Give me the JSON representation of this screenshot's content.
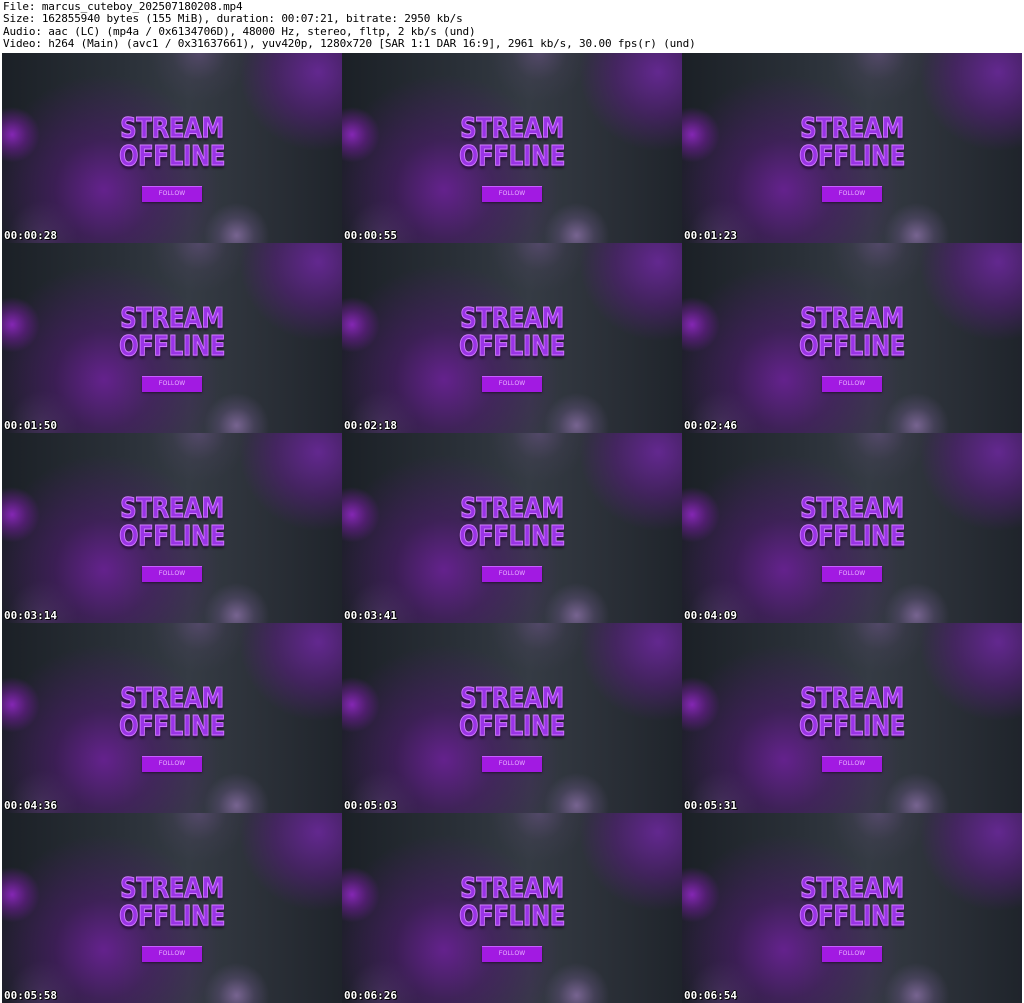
{
  "header": {
    "file": "File: marcus_cuteboy_202507180208.mp4",
    "size": "Size: 162855940 bytes (155 MiB), duration: 00:07:21, bitrate: 2950 kb/s",
    "audio": "Audio: aac (LC) (mp4a / 0x6134706D), 48000 Hz, stereo, fltp, 2 kb/s (und)",
    "video": "Video: h264 (Main) (avc1 / 0x31637661), yuv420p, 1280x720 [SAR 1:1 DAR 16:9], 2961 kb/s, 30.00 fps(r) (und)"
  },
  "frame_content": {
    "title_line1": "STREAM",
    "title_line2": "OFFLINE",
    "button_label": "FOLLOW"
  },
  "colors": {
    "title_purple": "#9a34e6",
    "button_purple": "#a21ae2",
    "background_dark": "#2a3038"
  },
  "thumbnails": [
    {
      "timestamp": "00:00:28"
    },
    {
      "timestamp": "00:00:55"
    },
    {
      "timestamp": "00:01:23"
    },
    {
      "timestamp": "00:01:50"
    },
    {
      "timestamp": "00:02:18"
    },
    {
      "timestamp": "00:02:46"
    },
    {
      "timestamp": "00:03:14"
    },
    {
      "timestamp": "00:03:41"
    },
    {
      "timestamp": "00:04:09"
    },
    {
      "timestamp": "00:04:36"
    },
    {
      "timestamp": "00:05:03"
    },
    {
      "timestamp": "00:05:31"
    },
    {
      "timestamp": "00:05:58"
    },
    {
      "timestamp": "00:06:26"
    },
    {
      "timestamp": "00:06:54"
    }
  ]
}
